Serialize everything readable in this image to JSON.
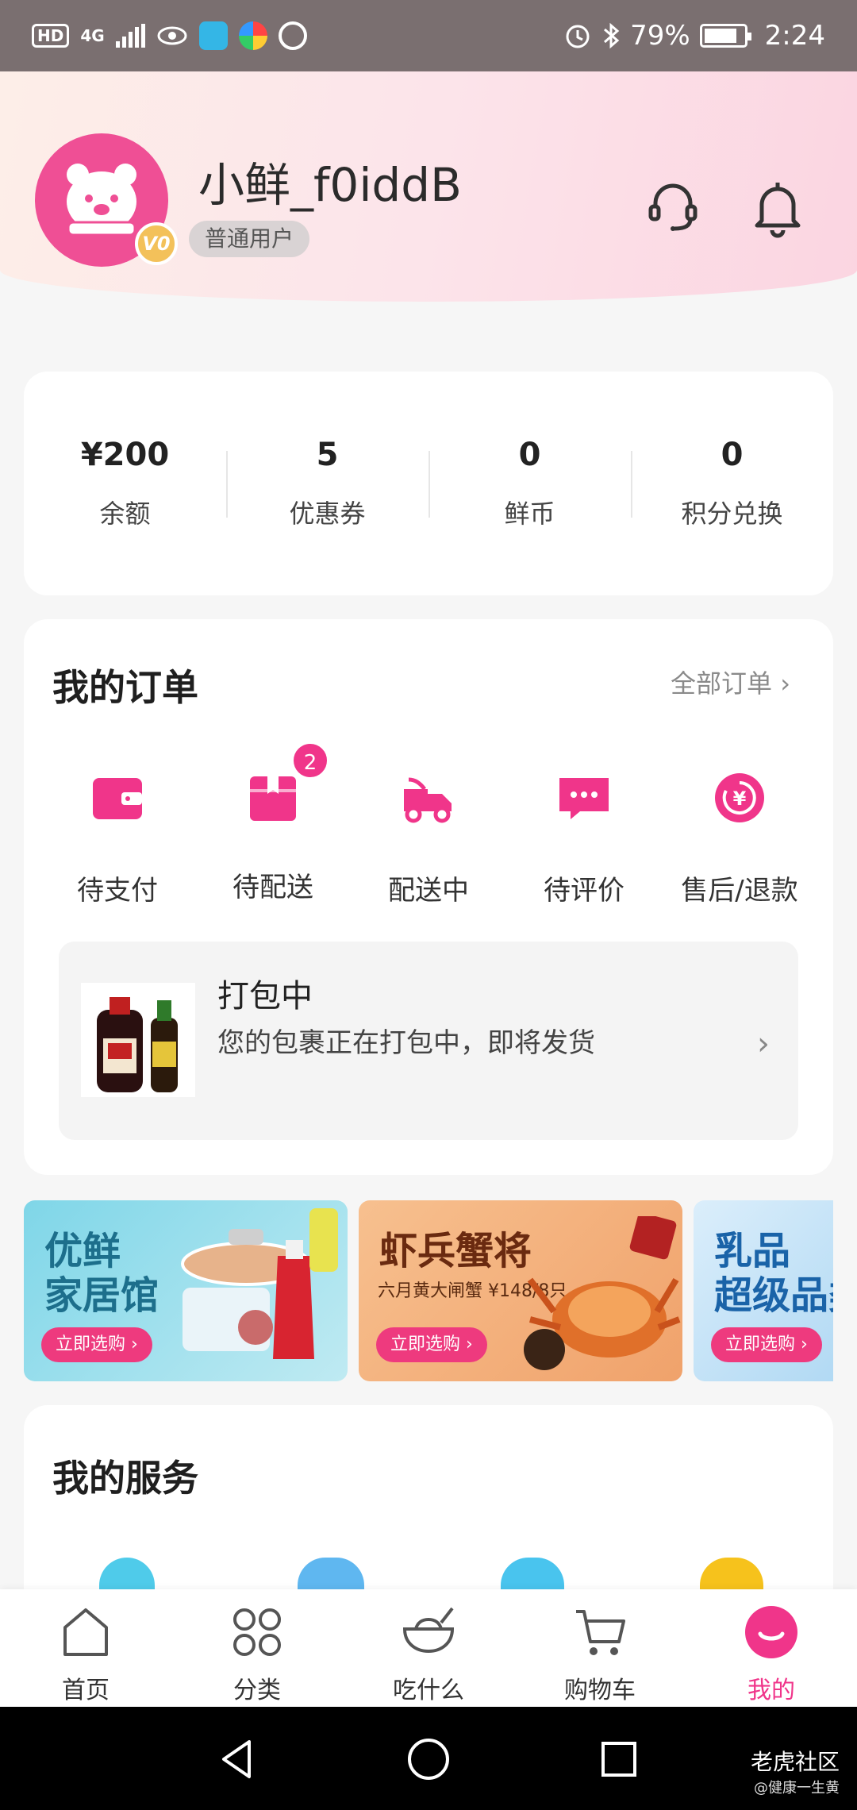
{
  "status_bar": {
    "hd": "HD",
    "net": "4G",
    "battery_pct": "79%",
    "time": "2:24"
  },
  "profile": {
    "username": "小鲜_f0iddB",
    "level_badge": "V0",
    "level_label": "普通用户"
  },
  "stats": [
    {
      "value": "¥200",
      "label": "余额"
    },
    {
      "value": "5",
      "label": "优惠券"
    },
    {
      "value": "0",
      "label": "鲜币"
    },
    {
      "value": "0",
      "label": "积分兑换"
    }
  ],
  "orders": {
    "title": "我的订单",
    "all_label": "全部订单 ›",
    "items": [
      {
        "label": "待支付",
        "icon": "wallet-icon"
      },
      {
        "label": "待配送",
        "icon": "package-icon",
        "badge": "2"
      },
      {
        "label": "配送中",
        "icon": "delivery-truck-icon"
      },
      {
        "label": "待评价",
        "icon": "comment-icon"
      },
      {
        "label": "售后/退款",
        "icon": "refund-icon"
      }
    ],
    "packing": {
      "title": "打包中",
      "desc": "您的包裹正在打包中，即将发货"
    }
  },
  "banners": [
    {
      "title": "优鲜\n家居馆",
      "button": "立即选购 ›"
    },
    {
      "title": "虾兵蟹将",
      "sub": "六月黄大闸蟹 ¥148/8只",
      "button": "立即选购 ›"
    },
    {
      "title": "乳品\n超级品类",
      "button": "立即选购 ›"
    }
  ],
  "services": {
    "title": "我的服务"
  },
  "tabbar": [
    {
      "label": "首页",
      "icon": "home-icon"
    },
    {
      "label": "分类",
      "icon": "category-icon"
    },
    {
      "label": "吃什么",
      "icon": "bowl-icon"
    },
    {
      "label": "购物车",
      "icon": "cart-icon"
    },
    {
      "label": "我的",
      "icon": "smile-icon",
      "active": true
    }
  ],
  "watermark": {
    "title": "老虎社区",
    "sub": "@健康一生黄"
  },
  "colors": {
    "accent": "#f0358a",
    "avatar_bg": "#ef4f95"
  }
}
